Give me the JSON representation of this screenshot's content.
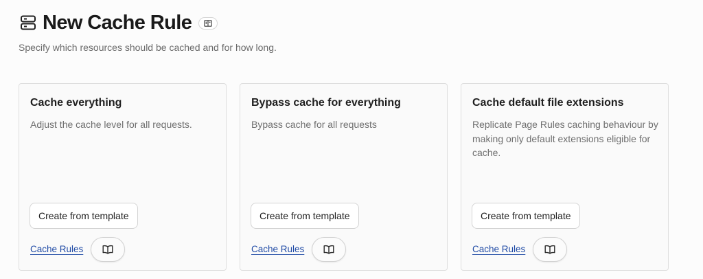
{
  "header": {
    "icon": "server-stack-icon",
    "title": "New Cache Rule",
    "badge_icon": "documentation-icon",
    "subtitle": "Specify which resources should be cached and for how long."
  },
  "cards": [
    {
      "title": "Cache everything",
      "description": "Adjust the cache level for all requests.",
      "button_label": "Create from template",
      "link_label": "Cache Rules",
      "doc_icon": "book-icon"
    },
    {
      "title": "Bypass cache for everything",
      "description": "Bypass cache for all requests",
      "button_label": "Create from template",
      "link_label": "Cache Rules",
      "doc_icon": "book-icon"
    },
    {
      "title": "Cache default file extensions",
      "description": "Replicate Page Rules caching behaviour by making only default extensions eligible for cache.",
      "button_label": "Create from template",
      "link_label": "Cache Rules",
      "doc_icon": "book-icon"
    }
  ],
  "colors": {
    "link": "#1f4aa5",
    "text": "#1f1f1f",
    "muted": "#6e6e6e",
    "border": "#dedede"
  }
}
